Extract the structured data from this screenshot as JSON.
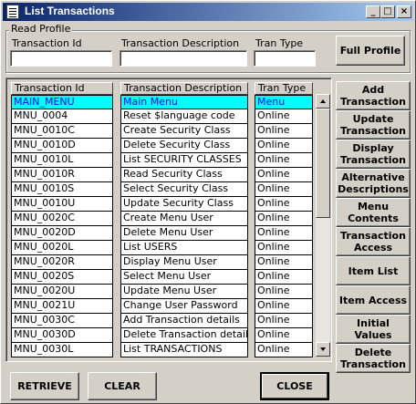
{
  "window": {
    "title": "List Transactions",
    "min_glyph": "_",
    "max_glyph": "□",
    "close_glyph": "×"
  },
  "read_profile": {
    "group_label": "Read Profile",
    "transaction_id_label": "Transaction Id",
    "transaction_id_value": "",
    "description_label": "Transaction Description",
    "description_value": "",
    "tran_type_label": "Tran Type",
    "tran_type_value": "",
    "full_profile_button": "Full Profile"
  },
  "list": {
    "headers": [
      "Transaction Id",
      "Transaction Description",
      "Tran Type"
    ],
    "selected_index": 0,
    "rows": [
      {
        "id": "MAIN_MENU",
        "desc": "Main Menu",
        "type": "Menu"
      },
      {
        "id": "MNU_0004",
        "desc": "Reset $language code",
        "type": "Online"
      },
      {
        "id": "MNU_0010C",
        "desc": "Create Security Class",
        "type": "Online"
      },
      {
        "id": "MNU_0010D",
        "desc": "Delete Security Class",
        "type": "Online"
      },
      {
        "id": "MNU_0010L",
        "desc": "List SECURITY CLASSES",
        "type": "Online"
      },
      {
        "id": "MNU_0010R",
        "desc": "Read Security Class",
        "type": "Online"
      },
      {
        "id": "MNU_0010S",
        "desc": "Select Security Class",
        "type": "Online"
      },
      {
        "id": "MNU_0010U",
        "desc": "Update Security Class",
        "type": "Online"
      },
      {
        "id": "MNU_0020C",
        "desc": "Create Menu User",
        "type": "Online"
      },
      {
        "id": "MNU_0020D",
        "desc": "Delete Menu User",
        "type": "Online"
      },
      {
        "id": "MNU_0020L",
        "desc": "List USERS",
        "type": "Online"
      },
      {
        "id": "MNU_0020R",
        "desc": "Display Menu User",
        "type": "Online"
      },
      {
        "id": "MNU_0020S",
        "desc": "Select Menu User",
        "type": "Online"
      },
      {
        "id": "MNU_0020U",
        "desc": "Update Menu User",
        "type": "Online"
      },
      {
        "id": "MNU_0021U",
        "desc": "Change User Password",
        "type": "Online"
      },
      {
        "id": "MNU_0030C",
        "desc": "Add Transaction details",
        "type": "Online"
      },
      {
        "id": "MNU_0030D",
        "desc": "Delete Transaction details",
        "type": "Online"
      },
      {
        "id": "MNU_0030L",
        "desc": "List TRANSACTIONS",
        "type": "Online"
      }
    ]
  },
  "side_buttons": [
    "Add Transaction",
    "Update Transaction",
    "Display Transaction",
    "Alternative Descriptions",
    "Menu Contents",
    "Transaction Access",
    "Item List",
    "Item Access",
    "Initial Values",
    "Delete Transaction"
  ],
  "bottom_buttons": {
    "retrieve": "RETRIEVE",
    "clear": "CLEAR",
    "close": "CLOSE"
  }
}
